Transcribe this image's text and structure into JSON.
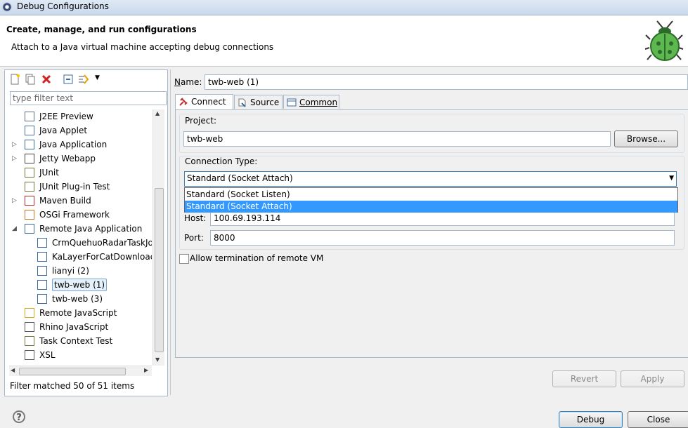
{
  "window": {
    "title": "Debug Configurations"
  },
  "header": {
    "title": "Create, manage, and run configurations",
    "subtitle": "Attach to a Java virtual machine accepting debug connections"
  },
  "left": {
    "filter_placeholder": "type filter text",
    "tree": [
      {
        "label": "J2EE Preview",
        "icon": "j2ee-icon",
        "arrow": ""
      },
      {
        "label": "Java Applet",
        "icon": "java-applet-icon",
        "arrow": ""
      },
      {
        "label": "Java Application",
        "icon": "java-application-icon",
        "arrow": "▷"
      },
      {
        "label": "Jetty Webapp",
        "icon": "jetty-icon",
        "arrow": "▷"
      },
      {
        "label": "JUnit",
        "icon": "junit-icon",
        "arrow": ""
      },
      {
        "label": "JUnit Plug-in Test",
        "icon": "junit-plugin-icon",
        "arrow": ""
      },
      {
        "label": "Maven Build",
        "icon": "maven-icon",
        "arrow": "▷"
      },
      {
        "label": "OSGi Framework",
        "icon": "osgi-icon",
        "arrow": ""
      },
      {
        "label": "Remote Java Application",
        "icon": "remote-java-icon",
        "arrow": "◢"
      },
      {
        "label": "CrmQuehuoRadarTaskJo",
        "icon": "remote-config-icon",
        "arrow": ""
      },
      {
        "label": "KaLayerForCatDownloac",
        "icon": "remote-config-icon",
        "arrow": ""
      },
      {
        "label": "lianyi (2)",
        "icon": "remote-config-icon",
        "arrow": ""
      },
      {
        "label": "twb-web (1)",
        "icon": "remote-config-icon",
        "arrow": ""
      },
      {
        "label": "twb-web (3)",
        "icon": "remote-config-icon",
        "arrow": ""
      },
      {
        "label": "Remote JavaScript",
        "icon": "remote-javascript-icon",
        "arrow": ""
      },
      {
        "label": "Rhino JavaScript",
        "icon": "rhino-icon",
        "arrow": ""
      },
      {
        "label": "Task Context Test",
        "icon": "task-context-icon",
        "arrow": ""
      },
      {
        "label": "XSL",
        "icon": "xsl-icon",
        "arrow": ""
      }
    ],
    "filter_message": "Filter matched 50 of 51 items"
  },
  "right": {
    "name_label": "Name:",
    "name_value": "twb-web (1)",
    "tabs": [
      "Connect",
      "Source",
      "Common"
    ],
    "project_label": "Project:",
    "project_value": "twb-web",
    "browse_label": "Browse...",
    "connection_type_label": "Connection Type:",
    "connection_type_value": "Standard (Socket Attach)",
    "connection_options": [
      "Standard (Socket Listen)",
      "Standard (Socket Attach)"
    ],
    "host_label": "Host:",
    "host_value": "100.69.193.114",
    "port_label": "Port:",
    "port_value": "8000",
    "allow_termination_label": "Allow termination of remote VM",
    "revert_label": "Revert",
    "apply_label": "Apply"
  },
  "footer": {
    "help_glyph": "?",
    "debug_label": "Debug",
    "close_label": "Close"
  },
  "colors": {
    "selection": "#3399ff",
    "tree_selection": "#e5f1fb"
  }
}
